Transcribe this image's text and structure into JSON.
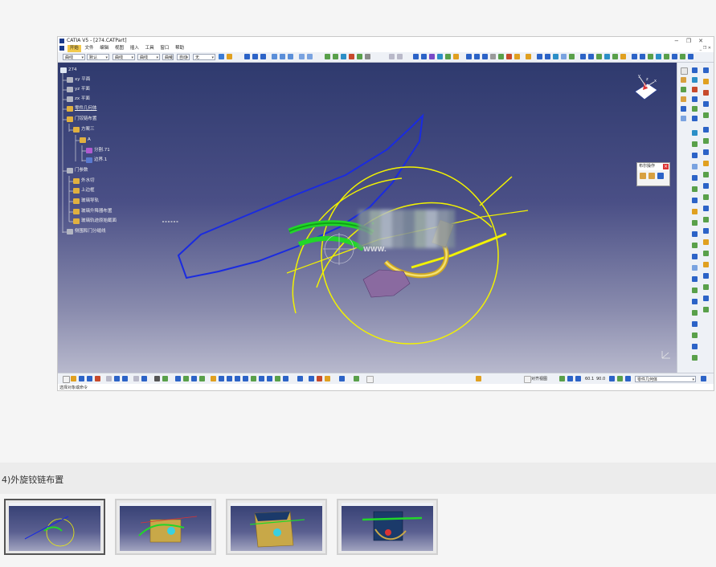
{
  "window": {
    "title": "CATIA V5 - [274.CATPart]",
    "controls": [
      "−",
      "❐",
      "✕"
    ]
  },
  "menu": {
    "items": [
      "开始",
      "文件",
      "编辑",
      "视图",
      "插入",
      "工具",
      "窗口",
      "帮助"
    ],
    "active_index": 0
  },
  "toolbar": {
    "combos": [
      "曲线",
      "默认",
      "曲线",
      "曲线",
      "曲线",
      "自动",
      "无"
    ]
  },
  "tree": {
    "nodes": [
      {
        "label": "274"
      },
      {
        "label": "xy 平面"
      },
      {
        "label": "yz 平面"
      },
      {
        "label": "zx 平面"
      },
      {
        "label": "零件几何体"
      },
      {
        "label": "门铰链布置"
      },
      {
        "label": "方案三"
      },
      {
        "label": "A"
      },
      {
        "label": "分割.71"
      },
      {
        "label": "边界.1"
      },
      {
        "label": "门参数"
      },
      {
        "label": "外水切"
      },
      {
        "label": "上边框"
      },
      {
        "label": "玻璃导轨"
      },
      {
        "label": "玻璃升降器布置"
      },
      {
        "label": "玻璃轨迹原始截面"
      },
      {
        "label": "侧围和门分缝线"
      }
    ]
  },
  "layout_panel": {
    "title": "布尔操作",
    "close": "×"
  },
  "viewport": {
    "watermark": "WWW."
  },
  "bottom_toolbar": {
    "snap_label": "对齐视图",
    "part_combo": "零件几何体",
    "zoom_a": "60.1",
    "zoom_b": "90.0"
  },
  "status": {
    "text": "选择对象或命令"
  },
  "caption": {
    "text": "4)外旋铰链布置"
  },
  "thumbnails": [
    {
      "active": true
    },
    {
      "active": false
    },
    {
      "active": false
    },
    {
      "active": false
    }
  ],
  "colors": {
    "viewport_top": "#2f3a6e",
    "curve_yellow": "#f2f200",
    "curve_blue": "#1a2be0",
    "part_green": "#22d62a"
  }
}
